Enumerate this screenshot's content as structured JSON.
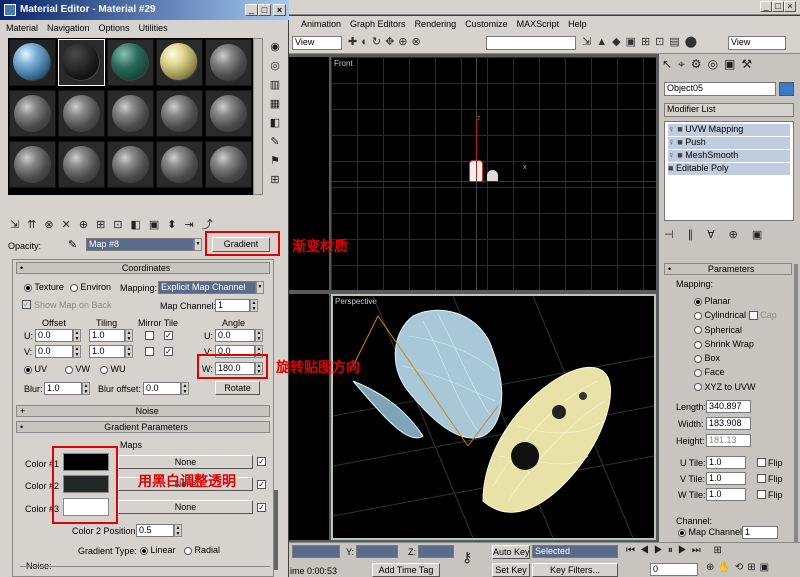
{
  "material_editor": {
    "title": "Material Editor - Material #29",
    "menu": [
      "Material",
      "Navigation",
      "Options",
      "Utilities"
    ],
    "opacity_label": "Opacity:",
    "map_name": "Map #8",
    "map_type": "Gradient",
    "coords": {
      "title": "Coordinates",
      "texture": "Texture",
      "environ": "Environ",
      "mapping_label": "Mapping:",
      "mapping_value": "Explicit Map Channel",
      "show_map_on_back": "Show Map on Back",
      "map_channel_label": "Map Channel:",
      "map_channel_value": "1",
      "offset": "Offset",
      "tiling": "Tiling",
      "mirror_tile": "Mirror Tile",
      "angle": "Angle",
      "u": "U:",
      "v": "V:",
      "w": "W:",
      "u_offset": "0.0",
      "v_offset": "0.0",
      "u_tiling": "1.0",
      "v_tiling": "1.0",
      "u_angle": "0.0",
      "v_angle": "0.0",
      "w_angle": "180.0",
      "uv": "UV",
      "vw": "VW",
      "wu": "WU",
      "blur_label": "Blur:",
      "blur": "1.0",
      "blur_offset_label": "Blur offset:",
      "blur_offset": "0.0",
      "rotate": "Rotate"
    },
    "noise_title": "Noise",
    "grad": {
      "title": "Gradient Parameters",
      "maps": "Maps",
      "color1": "Color #1",
      "color2": "Color #2",
      "color3": "Color #3",
      "none": "None",
      "color2_pos_label": "Color 2 Position:",
      "color2_pos": "0.5",
      "gradient_type": "Gradient Type:",
      "linear": "Linear",
      "radial": "Radial",
      "noise": "Noise:"
    }
  },
  "main_menu": [
    "Animation",
    "Graph Editors",
    "Rendering",
    "Customize",
    "MAXScript",
    "Help"
  ],
  "toolbar": {
    "view1": "View",
    "view2": "View"
  },
  "viewports": {
    "front": "Front",
    "perspective": "Perspective"
  },
  "cmd": {
    "object_name": "Object05",
    "modifier_list": "Modifier List",
    "stack": [
      "UVW Mapping",
      "Push",
      "MeshSmooth",
      "Editable Poly"
    ],
    "params_title": "Parameters",
    "mapping_title": "Mapping:",
    "mapping_options": [
      "Planar",
      "Cylindrical",
      "Spherical",
      "Shrink Wrap",
      "Box",
      "Face",
      "XYZ to UVW"
    ],
    "cap": "Cap",
    "length_label": "Length:",
    "length": "340.897",
    "width_label": "Width:",
    "width": "183.908",
    "height_label": "Height:",
    "height": "181.13",
    "utile_label": "U Tile:",
    "utile": "1.0",
    "vtile_label": "V Tile:",
    "vtile": "1.0",
    "wtile_label": "W Tile:",
    "wtile": "1.0",
    "flip": "Flip",
    "channel_title": "Channel:",
    "map_channel": "Map Channel:",
    "map_channel_value": "1"
  },
  "bottom": {
    "y": "Y:",
    "z": "Z:",
    "auto_key": "Auto Key",
    "set_key": "Set Key",
    "selected": "Selected",
    "key_filters": "Key Filters...",
    "time": "ime  0:00:53",
    "add_time_tag": "Add Time Tag",
    "frame": "0"
  },
  "annotations": {
    "gradient_material": "渐变材质",
    "rotate_direction": "旋转贴图方向",
    "bw_transparency": "用黑白调整透明"
  }
}
